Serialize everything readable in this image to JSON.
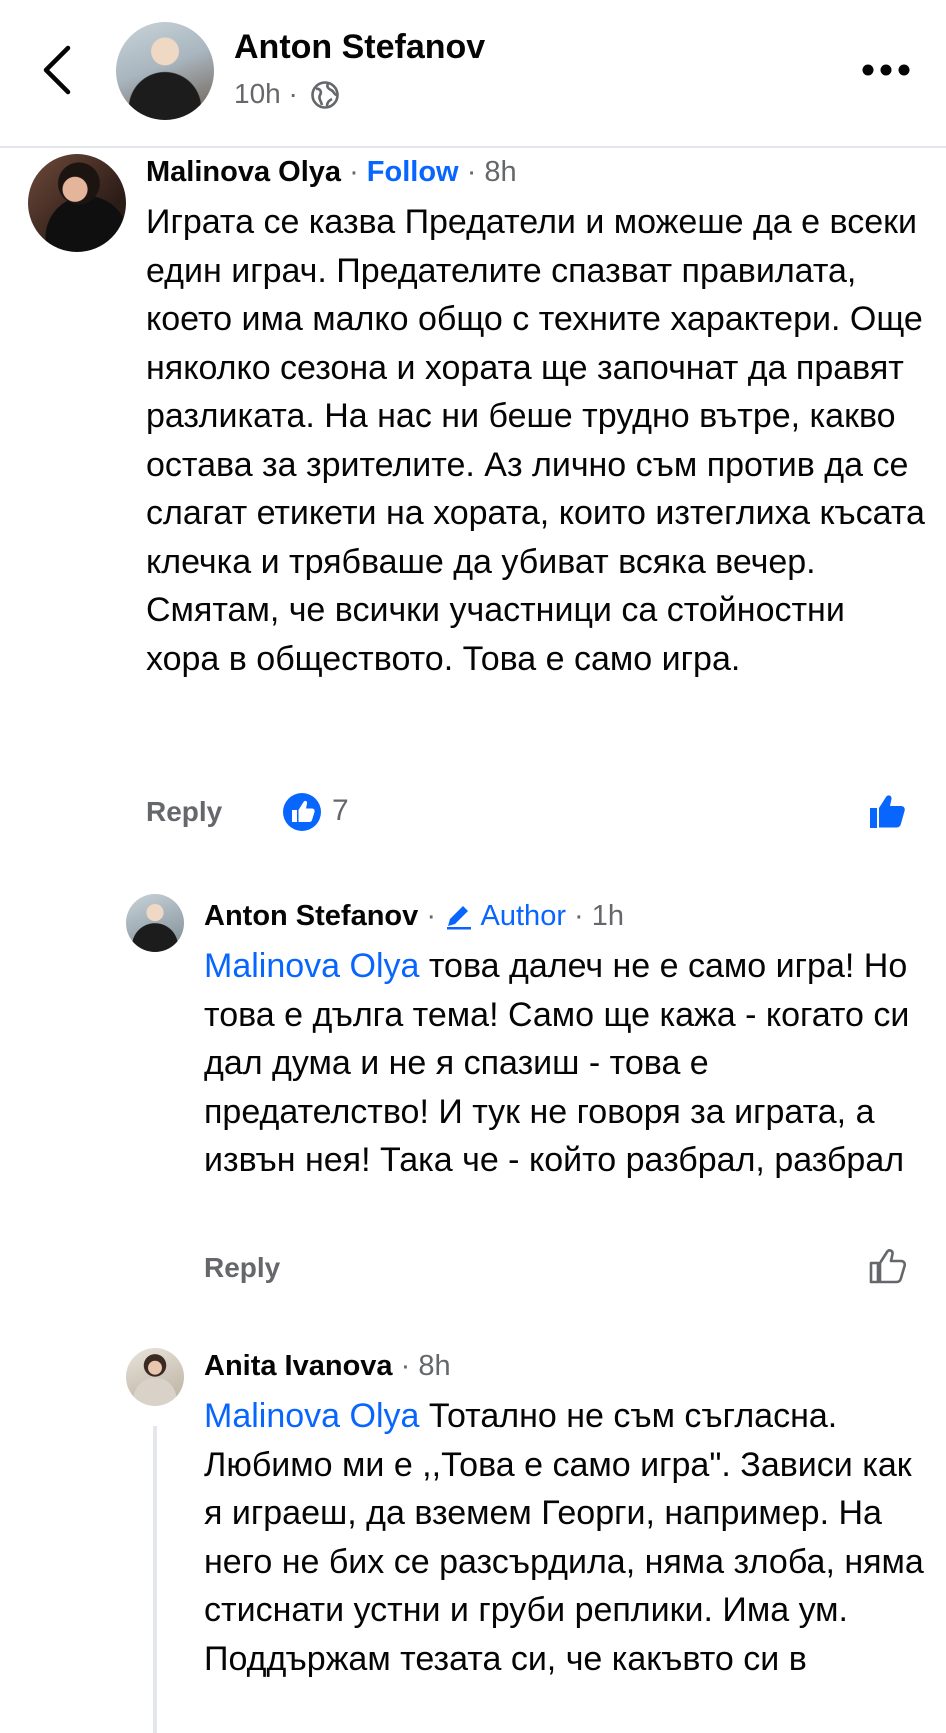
{
  "header": {
    "author_name": "Anton Stefanov",
    "post_time": "10h ·",
    "icons": {
      "back": "chevron-left-icon",
      "audience": "globe-icon",
      "more": "more-horizontal-icon"
    }
  },
  "comments": [
    {
      "author": "Malinova Olya",
      "follow_label": "Follow",
      "time": "8h",
      "text": "Играта се казва Предатели и можеше да е всеки един играч. Предателите спазват правилата, което има малко общо с техните характери. Още няколко сезона и хората ще започнат да правят разликата. На нас ни беше трудно вътре, какво остава за зрителите. Аз лично съм против да се слагат етикети на хората, които изтеглиха късата клечка и трябваше да убиват всяка вечер. Смятам, че всички участници са стойностни хора в обществото. Това е само игра.",
      "reply_label": "Reply",
      "like_count": "7",
      "liked": true
    },
    {
      "author": "Anton Stefanov",
      "badge_label": "Author",
      "time": "1h",
      "mention": "Malinova Olya",
      "text": " това далеч не е само игра! Но това е дълга тема! Само ще кажа - когато си дал дума и не я спазиш - това е предателство! И тук не говоря за играта, а извън нея! Така че - който разбрал, разбрал",
      "reply_label": "Reply",
      "liked": false
    },
    {
      "author": "Anita Ivanova",
      "time": "8h",
      "mention": "Malinova Olya",
      "text": " Тотално не съм съгласна. Любимо ми е ,,Това е само игра\". Зависи как я играеш, да вземем Георги, например. На него не бих се разсърдила, няма злоба, няма стиснати устни и груби реплики. Има ум. Поддържам тезата си, че какъвто си в"
    }
  ],
  "colors": {
    "link_blue": "#0866ff",
    "text": "#050505",
    "secondary": "#65676b",
    "divider": "#e4e6eb"
  }
}
